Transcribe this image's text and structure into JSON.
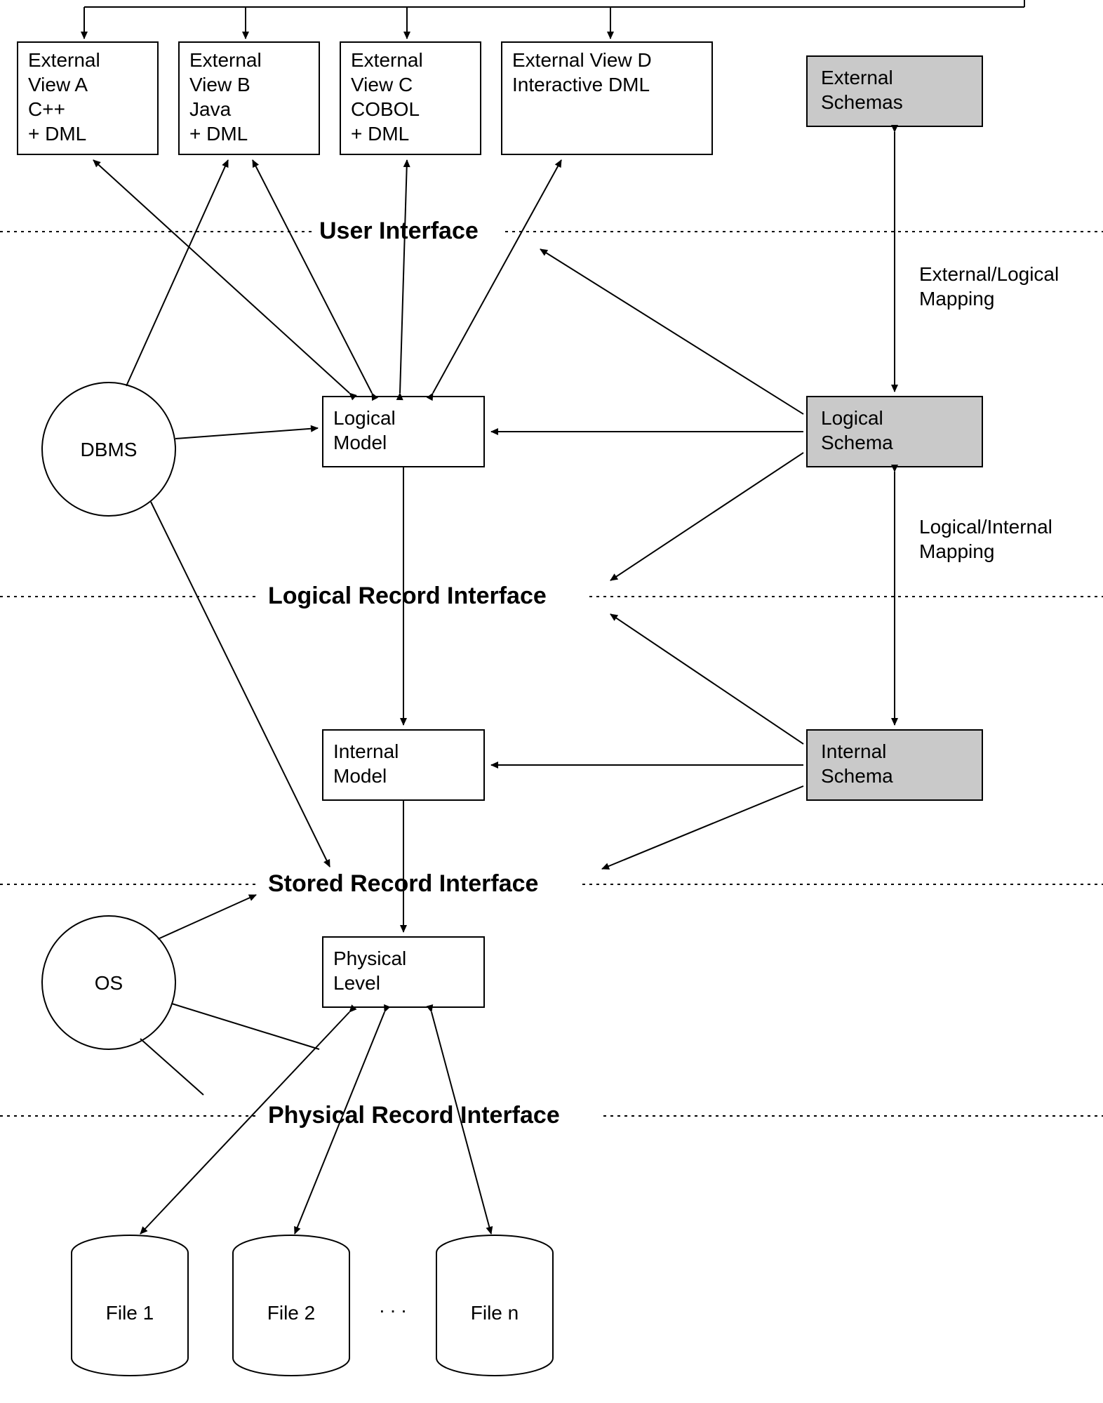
{
  "boxes": {
    "viewA": {
      "l1": "External",
      "l2": "View A",
      "l3": "C++",
      "l4": "+ DML"
    },
    "viewB": {
      "l1": "External",
      "l2": "View B",
      "l3": "Java",
      "l4": "+ DML"
    },
    "viewC": {
      "l1": "External",
      "l2": "View C",
      "l3": "COBOL",
      "l4": "+ DML"
    },
    "viewD": {
      "l1": "External View D",
      "l2": "Interactive DML"
    },
    "extSchemas": {
      "l1": "External",
      "l2": "Schemas"
    },
    "logicalModel": {
      "l1": "Logical",
      "l2": "Model"
    },
    "logicalSchema": {
      "l1": "Logical",
      "l2": "Schema"
    },
    "internalModel": {
      "l1": "Internal",
      "l2": "Model"
    },
    "internalSchema": {
      "l1": "Internal",
      "l2": "Schema"
    },
    "physicalLevel": {
      "l1": "Physical",
      "l2": "Level"
    }
  },
  "circles": {
    "dbms": "DBMS",
    "os": "OS"
  },
  "interfaces": {
    "ui": "User Interface",
    "lri": "Logical Record Interface",
    "sri": "Stored Record Interface",
    "pri": "Physical Record Interface"
  },
  "mappings": {
    "extLog": {
      "l1": "External/Logical",
      "l2": "Mapping"
    },
    "logInt": {
      "l1": "Logical/Internal",
      "l2": "Mapping"
    }
  },
  "files": {
    "f1": "File 1",
    "f2": "File 2",
    "dots": ". . .",
    "fn": "File n"
  }
}
